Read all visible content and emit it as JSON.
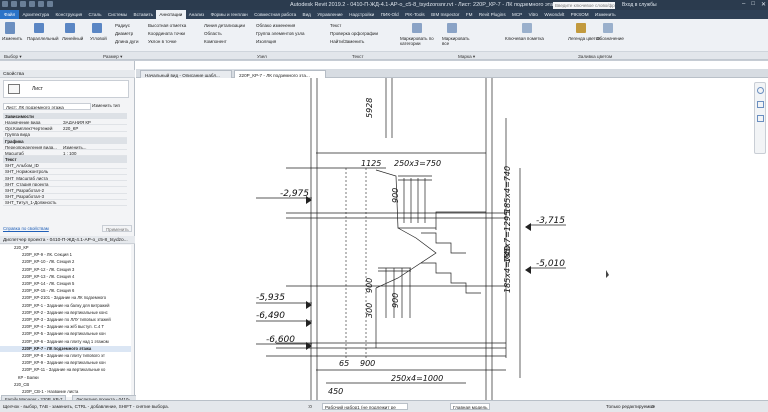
{
  "titlebar": {
    "title": "Autodesk Revit 2019.2 - 0410-П-ЖД-4.1-АР-о_с5-8_tsydzonsnr.rvt - Лист: 220Р_КР-7 - ЛК подземного этажа",
    "search_placeholder": "Введите ключевое слово/фразу",
    "sign_in": "Вход в службы",
    "close": "✕",
    "maximize": "□",
    "minimize": "–"
  },
  "tabs": [
    "Файл",
    "Архитектура",
    "Конструкция",
    "Сталь",
    "Системы",
    "Вставить",
    "Аннотации",
    "Анализ",
    "Формы и генплан",
    "Совместная работа",
    "Вид",
    "Управление",
    "Надстройки",
    "ПИК-Old",
    "PIK-Tools",
    "BIM Inspector",
    "FM",
    "Revit Plugins",
    "MCP",
    "Vitro",
    "Wwondvlt",
    "PIKSOM",
    "Изменить"
  ],
  "ribbon": {
    "modify": "Изменить",
    "dim_aligned": "Параллельный",
    "dim_linear": "Линейный",
    "dim_angular": "Угловой",
    "dim_radius": "Радиус",
    "dim_diameter": "Диаметр",
    "dim_arc": "Длина дуги",
    "spot_elev": "Высотная отметка",
    "spot_coord": "Координата точки",
    "spot_slope": "Уклон в точке",
    "detail_line": "Линия детализации",
    "region": "Область",
    "component": "Компонент",
    "revision_cloud": "Облако изменения",
    "detail_group": "Группа элементов узла",
    "insulation": "Изоляция",
    "text": "Текст",
    "spell": "Проверка орфографии",
    "find_replace": "Найти/Заменить",
    "tag_category": "Маркировать по категории",
    "tag_all": "Маркировать все",
    "keynote": "Ключевая пометка",
    "color_fill": "Легенда цветов",
    "symbol": "Обозначение"
  },
  "panels": {
    "select": "Выбор ▾",
    "dimension": "Размер ▾",
    "detail": "Узел",
    "text": "Текст",
    "tag": "Марка ▾",
    "color_fill": "Заливка цветом"
  },
  "properties": {
    "header": "Свойства",
    "type": "Лист",
    "filter": "Лист: ЛК подземного этажа",
    "edit_type": "Изменить тип",
    "groups": {
      "deps": "Зависимости",
      "graphics": "Графика",
      "text": "Текст"
    },
    "rows": [
      {
        "k": "Назначение вида",
        "v": "ЗАДАНИЯ КР"
      },
      {
        "k": "Орг.КомплектЧертежей",
        "v": "220_КР"
      },
      {
        "k": "Группа вида",
        "v": ""
      },
      {
        "k": "Переопределения вида...",
        "v": "Изменить..."
      },
      {
        "k": "Масштаб",
        "v": "1 : 100"
      },
      {
        "k": "SHT_Альбом_ID",
        "v": ""
      },
      {
        "k": "SHT_Нормоконтроль",
        "v": ""
      },
      {
        "k": "SHT_Масштаб листа",
        "v": ""
      },
      {
        "k": "SHT_Стадия проекта",
        "v": ""
      },
      {
        "k": "SHT_Разработал-2",
        "v": ""
      },
      {
        "k": "SHT_Разработал-3",
        "v": ""
      },
      {
        "k": "SHT_Титул_1-Должность",
        "v": ""
      }
    ],
    "help_link": "Справка по свойствам",
    "apply": "Применить"
  },
  "browser": {
    "header": "Диспетчер проекта - 0410-П-ЖД-4.1-АР-о_с5-8_tsydzo...",
    "items": [
      "220_КР",
      "220Р_КР-9 - ЛК. Секция 1",
      "220Р_КР-10 - ЛК. Секция 2",
      "220Р_КР-12 - ЛК. Секция 3",
      "220Р_КР-13 - ЛК. Секция 4",
      "220Р_КР-14 - ЛК. Секция 5",
      "220Р_КР-15 - ЛК. Секция 6",
      "220Р_КР-2101 - Задание на ЛК подземного",
      "220Р_КР-1 - Задание на балку для витражей",
      "220Р_КР-2 - Задание на вертикальные конс",
      "220Р_КР-3 - Задание по ЛЛУ типовых этажей",
      "220Р_КР-4 - Задание на ж/б выступ. С.4 Т",
      "220Р_КР-5 - Задание на вертикальные кон",
      "220Р_КР-6 - Задание на плиту над 1 этажом",
      "220Р_КР-7 - ЛК подземного этажа",
      "220Р_КР-8 - Задание на плиту типового эт",
      "220Р_КР-9 - Задание на вертикальные кон",
      "220Р_КР-11 - Задание на вертикальные ко",
      "КР - Балки",
      "220_СВ",
      "220Р_СВ-1 - Название листа"
    ]
  },
  "doc_tabs": [
    "Начальный вид - Описание шабл...",
    "220Р_КР-7 - ЛК подземного эта..."
  ],
  "drawing": {
    "dims": [
      "5928",
      "1125",
      "250x3=750",
      "900",
      "185x4=740",
      "185x7=1295",
      "185x4=740",
      "900",
      "300",
      "900",
      "65",
      "900",
      "250x4=1000",
      "450"
    ],
    "elevs": [
      "-2,975",
      "-3,715",
      "-5,010",
      "-5,935",
      "-6,490",
      "-6,600"
    ]
  },
  "bottom_tabs": [
    "Family Manager - 220Р_КР-7",
    "Диспетчер проекта - 0410-..."
  ],
  "status": {
    "hint": "Щелчок - выбор, TAB - заменить, CTRL - добавление, SHIFT - снятие выбора.",
    "scale_value": ":0",
    "workset": "Рабочий набор1 (не подлежит ре",
    "model": "Главная модель",
    "editable_only": "Только редактируемые",
    "filter_count": ":0"
  }
}
